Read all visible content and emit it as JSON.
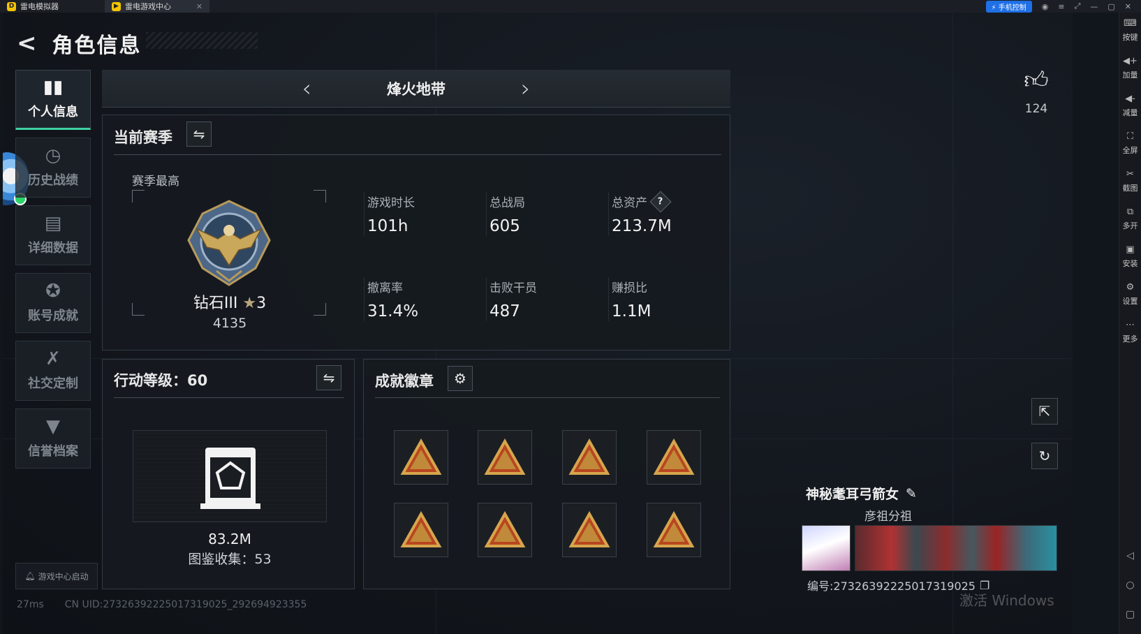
{
  "emulator": {
    "tabs": [
      {
        "label": "雷电模拟器"
      },
      {
        "label": "雷电游戏中心"
      }
    ],
    "phone_control": "手机控制",
    "toolbar": [
      {
        "icon": "keyboard-icon",
        "label": "按键"
      },
      {
        "icon": "volume-up-icon",
        "label": "加量"
      },
      {
        "icon": "volume-down-icon",
        "label": "减量"
      },
      {
        "icon": "fullscreen-icon",
        "label": "全屏"
      },
      {
        "icon": "scissors-icon",
        "label": "截图"
      },
      {
        "icon": "multi-instance-icon",
        "label": "多开"
      },
      {
        "icon": "install-icon",
        "label": "安装"
      },
      {
        "icon": "gear-icon",
        "label": "设置"
      },
      {
        "icon": "more-icon",
        "label": "更多"
      }
    ]
  },
  "header": {
    "title": "角色信息"
  },
  "nav": {
    "items": [
      {
        "label": "个人信息",
        "icon": "bar-chart-icon",
        "active": true
      },
      {
        "label": "历史战绩",
        "icon": "clock-icon",
        "active": false
      },
      {
        "label": "详细数据",
        "icon": "folder-icon",
        "active": false
      },
      {
        "label": "账号成就",
        "icon": "star-badge-icon",
        "active": false
      },
      {
        "label": "社交定制",
        "icon": "tools-icon",
        "active": false
      },
      {
        "label": "信誉档案",
        "icon": "shield-icon",
        "active": false
      }
    ],
    "start_label": "游戏中心启动"
  },
  "mode": {
    "name": "烽火地带"
  },
  "season": {
    "title": "当前赛季",
    "best_label": "赛季最高",
    "rank_name": "钻石III",
    "rank_stars": "3",
    "rank_score": "4135",
    "stats": [
      {
        "label": "游戏时长",
        "value": "101h"
      },
      {
        "label": "总战局",
        "value": "605"
      },
      {
        "label": "总资产",
        "value": "213.7M",
        "help": "?"
      },
      {
        "label": "撤离率",
        "value": "31.4%"
      },
      {
        "label": "击败干员",
        "value": "487"
      },
      {
        "label": "赚损比",
        "value": "1.1M"
      }
    ]
  },
  "level": {
    "title": "行动等级：60",
    "value": "83.2M",
    "collection": "图鉴收集：53"
  },
  "achievements": {
    "title": "成就徽章",
    "badge_count": 8
  },
  "likes": {
    "count": "124"
  },
  "player": {
    "name": "神秘耄耳弓箭女",
    "clan": "彦祖分祖",
    "uid": "编号:27326392225017319025"
  },
  "status": {
    "ping": "27ms",
    "cn_uid": "CN UID:27326392225017319025_292694923355"
  },
  "watermark": "激活 Windows",
  "colors": {
    "accent": "#3fd1a2",
    "bg": "#11161c"
  }
}
